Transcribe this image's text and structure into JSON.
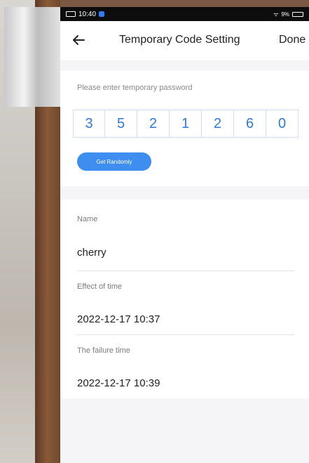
{
  "status_bar": {
    "time": "10:40",
    "right_text": "9%"
  },
  "header": {
    "title": "Temporary Code Setting",
    "done_label": "Done"
  },
  "password": {
    "prompt": "Please enter temporary password",
    "digits": [
      "3",
      "5",
      "2",
      "1",
      "2",
      "6",
      "0"
    ],
    "random_button": "Get Randomly"
  },
  "fields": {
    "name_label": "Name",
    "name_value": "cherry",
    "effect_label": "Effect of time",
    "effect_value": "2022-12-17 10:37",
    "failure_label": "The failure time",
    "failure_value": "2022-12-17 10:39"
  },
  "colors": {
    "accent": "#3e8ef0",
    "digit_text": "#2f79d8"
  }
}
